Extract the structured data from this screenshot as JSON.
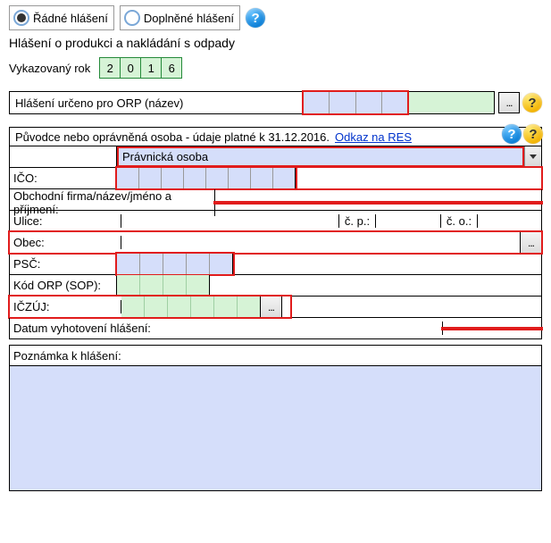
{
  "header": {
    "radio_regular": "Řádné hlášení",
    "radio_amended": "Doplněné hlášení",
    "title": "Hlášení o produkci a nakládání s odpady",
    "year_label": "Vykazovaný rok",
    "year_digits": [
      "2",
      "0",
      "1",
      "6"
    ]
  },
  "orp": {
    "label": "Hlášení určeno pro ORP (název)",
    "ellipsis": "..."
  },
  "subject": {
    "section_text": "Původce nebo oprávněná osoba - údaje platné k 31.12.2016.",
    "res_link": "Odkaz na RES",
    "type_value": "Právnická osoba",
    "ico_label": "IČO:",
    "name_label": "Obchodní firma/název/jméno a příjmení:",
    "street_label": "Ulice:",
    "cp_label": "č. p.:",
    "co_label": "č. o.:",
    "obec_label": "Obec:",
    "psc_label": "PSČ:",
    "orp_code_label": "Kód ORP (SOP):",
    "iczuj_label": "IČZÚJ:",
    "date_label": "Datum vyhotovení hlášení:",
    "note_label": "Poznámka k hlášení:"
  },
  "icons": {
    "help_glyph": "?"
  }
}
